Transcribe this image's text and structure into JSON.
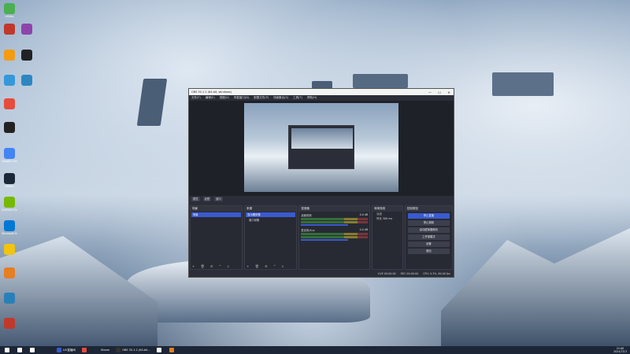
{
  "desktop": {
    "icons": [
      {
        "label": "nVidia",
        "color": "#4caf50"
      },
      {
        "label": "",
        "color": "#c0392b"
      },
      {
        "label": "",
        "color": "#8e44ad"
      },
      {
        "label": "",
        "color": "#f39c12"
      },
      {
        "label": "",
        "color": "#222222"
      },
      {
        "label": "",
        "color": "#3498db"
      },
      {
        "label": "",
        "color": "#2e86c1"
      },
      {
        "label": "",
        "color": "#e74c3c"
      },
      {
        "label": "",
        "color": "#222222"
      },
      {
        "label": "Google Chrome",
        "color": "#4285f4"
      },
      {
        "label": "Steam",
        "color": "#1b2838"
      },
      {
        "label": "GeForce Experience",
        "color": "#76b900"
      },
      {
        "label": "Microsoft Edge",
        "color": "#0078d4"
      },
      {
        "label": "",
        "color": "#f1c40f"
      },
      {
        "label": "",
        "color": "#e67e22"
      },
      {
        "label": "",
        "color": "#2980b9"
      },
      {
        "label": "",
        "color": "#c0392b"
      }
    ]
  },
  "chat_overlay": {
    "rows": [
      "",
      "",
      "",
      "",
      "",
      "",
      "",
      "",
      "",
      "",
      "",
      "",
      "",
      "",
      "",
      "",
      "",
      "",
      "",
      "",
      "",
      ""
    ]
  },
  "obs": {
    "title": "OBS 30.1.2 (64-bit, windows)",
    "window_buttons": [
      "—",
      "☐",
      "✕"
    ],
    "menu": [
      "文件(F)",
      "编辑(E)",
      "视图(V)",
      "停靠窗口(D)",
      "配置文件(P)",
      "场景集合(S)",
      "工具(T)",
      "帮助(H)"
    ],
    "controls": [
      "属性",
      "滤镜",
      "窗口"
    ],
    "docks": {
      "scenes": {
        "title": "场景",
        "items": [
          "场景"
        ],
        "toolbar": "+ 🗑 ⚙ ^ v"
      },
      "sources": {
        "title": "来源",
        "items": [
          "显示器采集",
          "窗口采集"
        ],
        "toolbar": "+ 🗑 ⚙ ^ v"
      },
      "mixer": {
        "title": "混音器",
        "channels": [
          {
            "name": "桌面音频",
            "db": "0.0 dB"
          },
          {
            "name": "麦克风/Aux",
            "db": "0.0 dB"
          }
        ]
      },
      "transitions": {
        "title": "转场特效",
        "items": [
          "淡出",
          "时长 300 ms"
        ]
      },
      "controls": {
        "title": "控制按钮",
        "buttons": [
          "停止直播",
          "停止录制",
          "启动虚拟摄像机",
          "工作室模式",
          "设置",
          "退出"
        ]
      }
    },
    "status": [
      "LIVE 00:00:00",
      "REC 00:00:00",
      "CPU: 0.3%, 60.00 fps"
    ]
  },
  "taskbar": {
    "items": [
      {
        "label": "",
        "color": "#ffffff"
      },
      {
        "label": "",
        "color": "#ffffff"
      },
      {
        "label": "",
        "color": "#ffffff"
      },
      {
        "label": "LIV直播间",
        "color": "#3a5acf"
      },
      {
        "label": "",
        "color": "#e74c3c"
      },
      {
        "label": "Steam",
        "color": "#1b2838"
      },
      {
        "label": "OBS 30.1.2 (64-bit...",
        "color": "#333333"
      },
      {
        "label": "",
        "color": "#ffffff"
      },
      {
        "label": "",
        "color": "#e67e22"
      }
    ],
    "time": "21:00",
    "date": "2024/7/13"
  }
}
